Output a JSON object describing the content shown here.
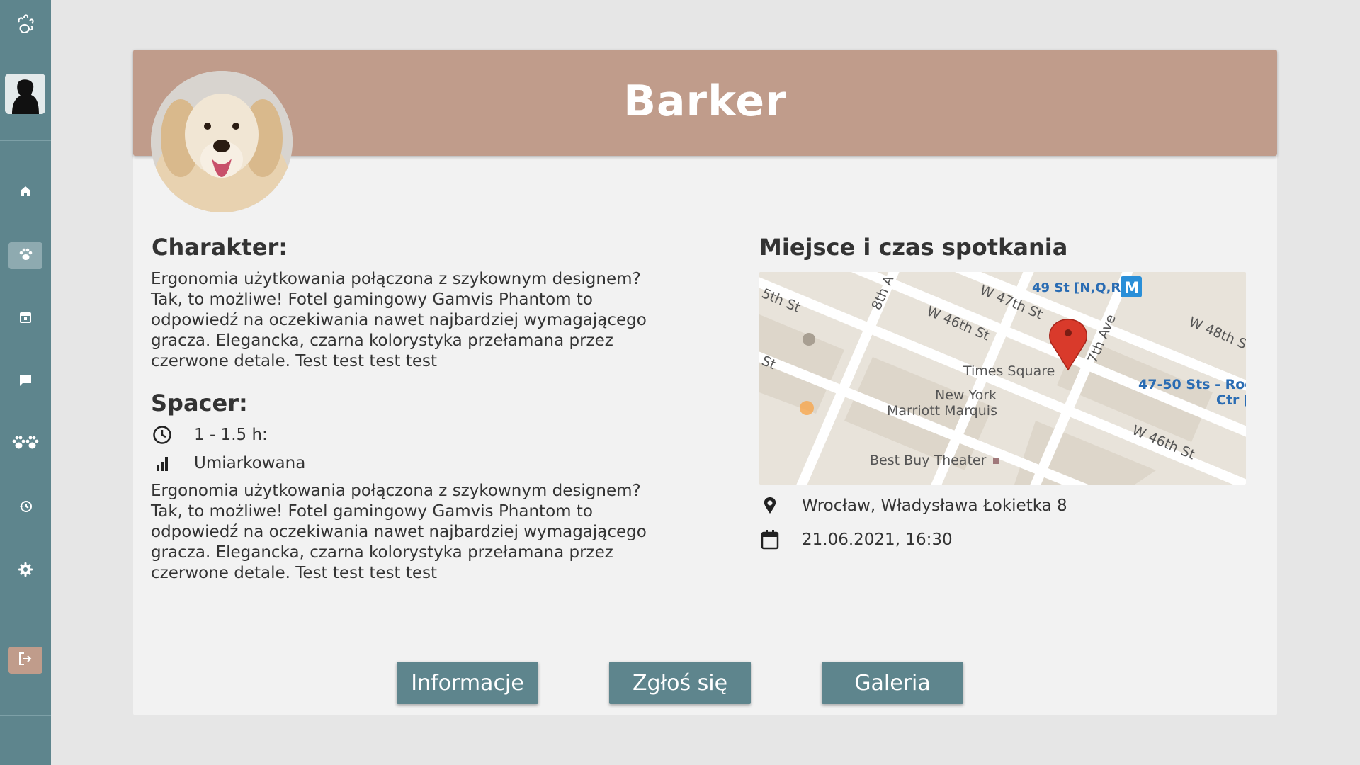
{
  "sidebar": {
    "items": [
      {
        "icon": "home-icon"
      },
      {
        "icon": "paw-icon",
        "active": true
      },
      {
        "icon": "calendar-icon"
      },
      {
        "icon": "chat-icon"
      },
      {
        "icon": "paws-group-icon"
      },
      {
        "icon": "history-icon"
      },
      {
        "icon": "gear-icon"
      }
    ],
    "logout_icon": "logout-icon"
  },
  "dog": {
    "name": "Barker"
  },
  "character": {
    "heading": "Charakter:",
    "text": "Ergonomia użytkowania połączona z szykownym designem? Tak, to możliwe! Fotel gamingowy Gamvis Phantom to odpowiedź na oczekiwania nawet najbardziej wymagającego gracza. Elegancka, czarna kolorystyka przełamana przez czerwone detale. Test test test test"
  },
  "walk": {
    "heading": "Spacer:",
    "duration": "1 - 1.5 h:",
    "intensity": "Umiarkowana",
    "text": "Ergonomia użytkowania połączona z szykownym designem? Tak, to możliwe! Fotel gamingowy Gamvis Phantom to odpowiedź na oczekiwania nawet najbardziej wymagającego gracza. Elegancka, czarna kolorystyka przełamana przez czerwone detale. Test test test test"
  },
  "meeting": {
    "heading": "Miejsce i czas spotkania",
    "address": "Wrocław, Władysława Łokietka 8",
    "datetime": "21.06.2021, 16:30",
    "map_labels": {
      "st_47": "W 47th St",
      "subway": "49 St [N,Q,R]",
      "st_48": "W 48th S",
      "st_46a": "W 46th St",
      "st_46b": "W 46th St",
      "ave_8": "8th A",
      "ave_7": "7th Ave",
      "st_45": "5th St",
      "st_x": "St",
      "times_square": "Times Square",
      "marriott": "New York Marriott Marquis",
      "marriott_1": "New York",
      "marriott_2": "Marriott Marquis",
      "station": "47-50 Sts - Roc",
      "station_2": "Ctr [I",
      "theater": "Best Buy Theater",
      "metro": "M"
    }
  },
  "buttons": {
    "info": "Informacje",
    "apply": "Zgłoś się",
    "gallery": "Galeria"
  },
  "colors": {
    "sidebar": "#5e858d",
    "banner": "#c09c8b",
    "button": "#5e858d",
    "pin": "#d93a2b"
  }
}
